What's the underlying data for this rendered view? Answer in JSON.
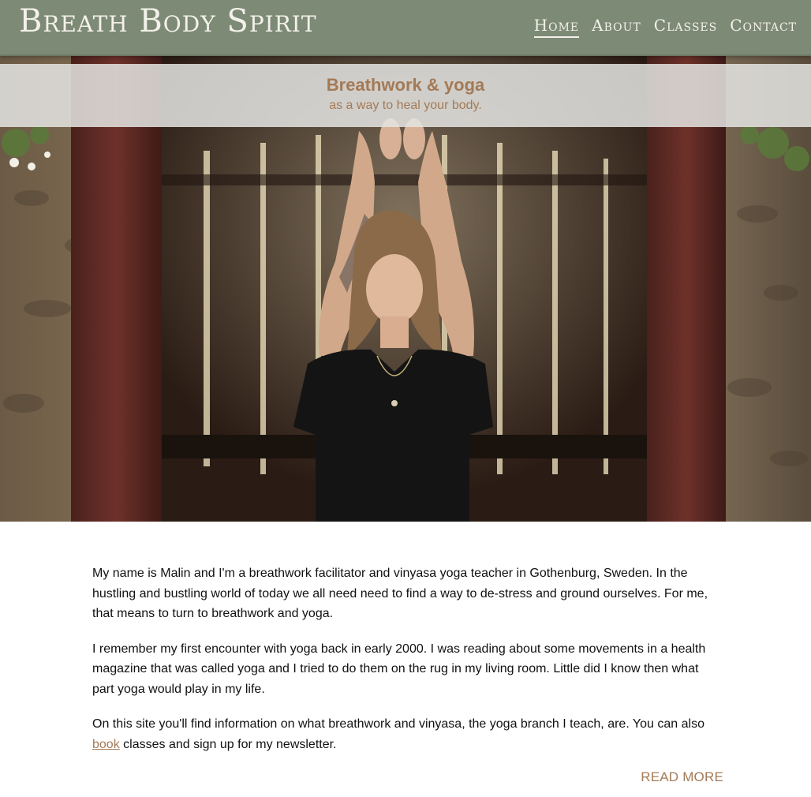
{
  "header": {
    "logo": "Breath Body Spirit",
    "nav": [
      {
        "label": "Home",
        "active": true
      },
      {
        "label": "About",
        "active": false
      },
      {
        "label": "Classes",
        "active": false
      },
      {
        "label": "Contact",
        "active": false
      }
    ]
  },
  "hero": {
    "title": "Breathwork & yoga",
    "subtitle": "as a way to heal your body."
  },
  "content": {
    "paragraph1": "My name is Malin and I'm a breathwork facilitator and vinyasa yoga teacher in Gothenburg, Sweden. In the hustling and bustling world of today we all need need to find a way to de-stress and ground ourselves. For me, that means to turn to breathwork and yoga.",
    "paragraph2": "I remember my first encounter with yoga back in early 2000. I was reading about some movements in a health magazine that was called yoga and I tried to do them on the rug in my living room. Little did I know then what part yoga would play in my life.",
    "paragraph3_before": "On this site you'll find information on what breathwork and vinyasa, the yoga branch I teach, are. You can also ",
    "paragraph3_link": "book",
    "paragraph3_after": " classes and sign up for my newsletter.",
    "read_more": "READ MORE"
  },
  "colors": {
    "header_bg": "#7d8a76",
    "accent": "#a47a56",
    "header_text": "#f3f1ea"
  }
}
